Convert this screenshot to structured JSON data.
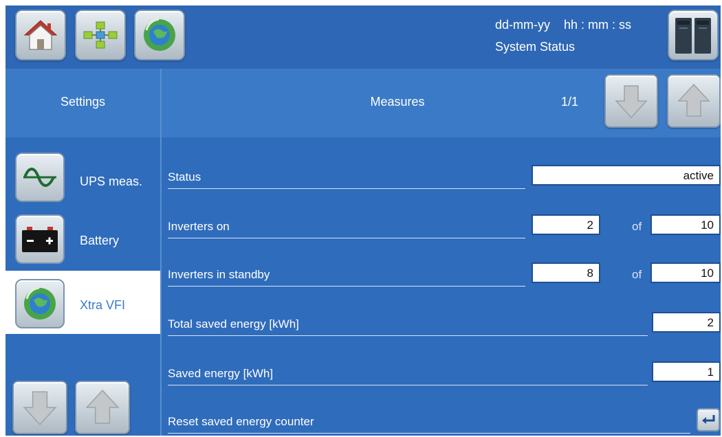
{
  "topbar": {
    "date": "dd-mm-yy",
    "time": "hh : mm : ss",
    "system_status": "System Status",
    "icons": [
      "home-icon",
      "network-icon",
      "globe-icon",
      "ups-cabinet-icon"
    ]
  },
  "header": {
    "left_title": "Settings",
    "center_title": "Measures",
    "page_indicator": "1/1"
  },
  "sidebar": {
    "items": [
      {
        "label": "UPS meas.",
        "icon": "sine-wave-icon",
        "selected": false
      },
      {
        "label": "Battery",
        "icon": "battery-icon",
        "selected": false
      },
      {
        "label": "Xtra VFI",
        "icon": "globe-icon",
        "selected": true
      }
    ]
  },
  "measures": {
    "status": {
      "label": "Status",
      "value": "active"
    },
    "inverters_on": {
      "label": "Inverters on",
      "value": "2",
      "of_label": "of",
      "total": "10"
    },
    "inverters_standby": {
      "label": "Inverters in standby",
      "value": "8",
      "of_label": "of",
      "total": "10"
    },
    "total_saved_energy": {
      "label": "Total saved energy [kWh]",
      "value": "2"
    },
    "saved_energy": {
      "label": "Saved energy [kWh]",
      "value": "1"
    },
    "reset_counter": {
      "label": "Reset saved energy counter"
    }
  },
  "colors": {
    "background": "#2f6cbc",
    "header": "#3b7ac6",
    "selected_item_bg": "#ffffff",
    "selected_item_text": "#3a7bc8"
  }
}
